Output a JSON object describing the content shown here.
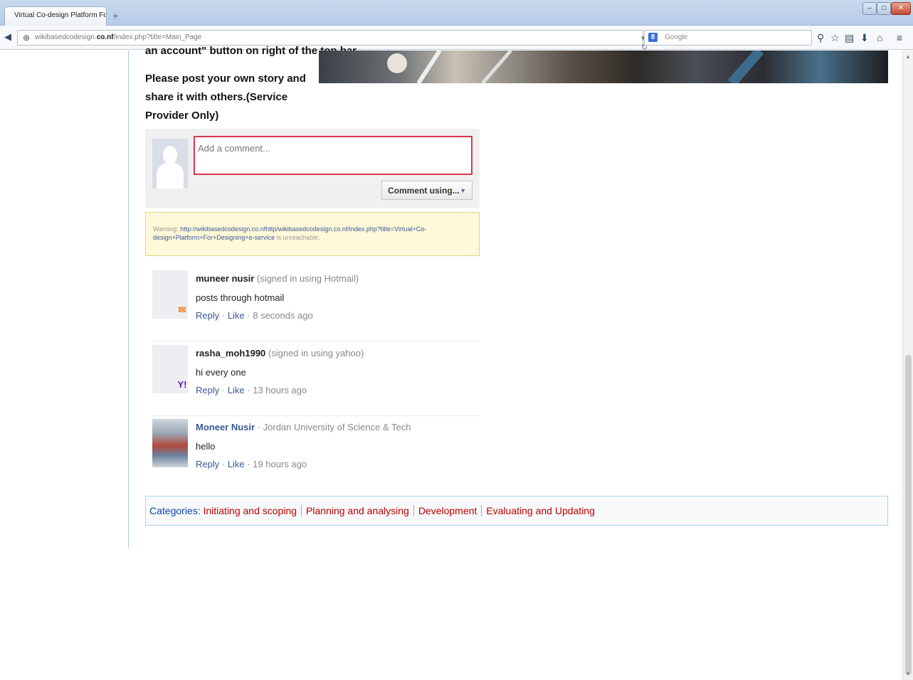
{
  "browser": {
    "tab_title": "Virtual Co-design Platform For Des...",
    "new_tab_symbol": "+",
    "url_prefix": "wikibasedcodesign.",
    "url_domain": "co.nf",
    "url_path": "/index.php?title=Main_Page",
    "search_placeholder": "Google",
    "search_engine_letter": "8"
  },
  "page": {
    "intro_cut": "an account\" button on right of the top bar.",
    "intro_text": "Please post your own story and share it with others.(Service Provider Only)"
  },
  "comment_form": {
    "placeholder": "Add a comment...",
    "comment_using_label": "Comment using..."
  },
  "warning": {
    "prefix": "Warning: ",
    "url": "http://wikibasedcodesign.co.nfhttp/wikibasedcodesign.co.nf/index.php?title=Virtual+Co-design+Platform+For+Designing+e-service",
    "suffix": " is unreachable."
  },
  "comments": [
    {
      "name": "muneer nusir",
      "sub": " (signed in using Hotmail)",
      "text": "posts through hotmail",
      "reply": "Reply",
      "like": "Like",
      "time": " · 8 seconds ago",
      "badge_color": "#f07d1a"
    },
    {
      "name": "rasha_moh1990",
      "sub": " (signed in using yahoo)",
      "text": "hi every one",
      "reply": "Reply",
      "like": "Like",
      "time": " · 13 hours ago",
      "badge_color": "#6a1b9a"
    },
    {
      "name": "Moneer Nusir",
      "sub": " · Jordan University of Science & Tech",
      "text": "hello",
      "reply": "Reply",
      "like": "Like",
      "time": " · 19 hours ago"
    }
  ],
  "categories": {
    "label": "Categories",
    "items": [
      "Initiating and scoping",
      "Planning and analysing",
      "Development",
      "Evaluating and Updating"
    ]
  }
}
